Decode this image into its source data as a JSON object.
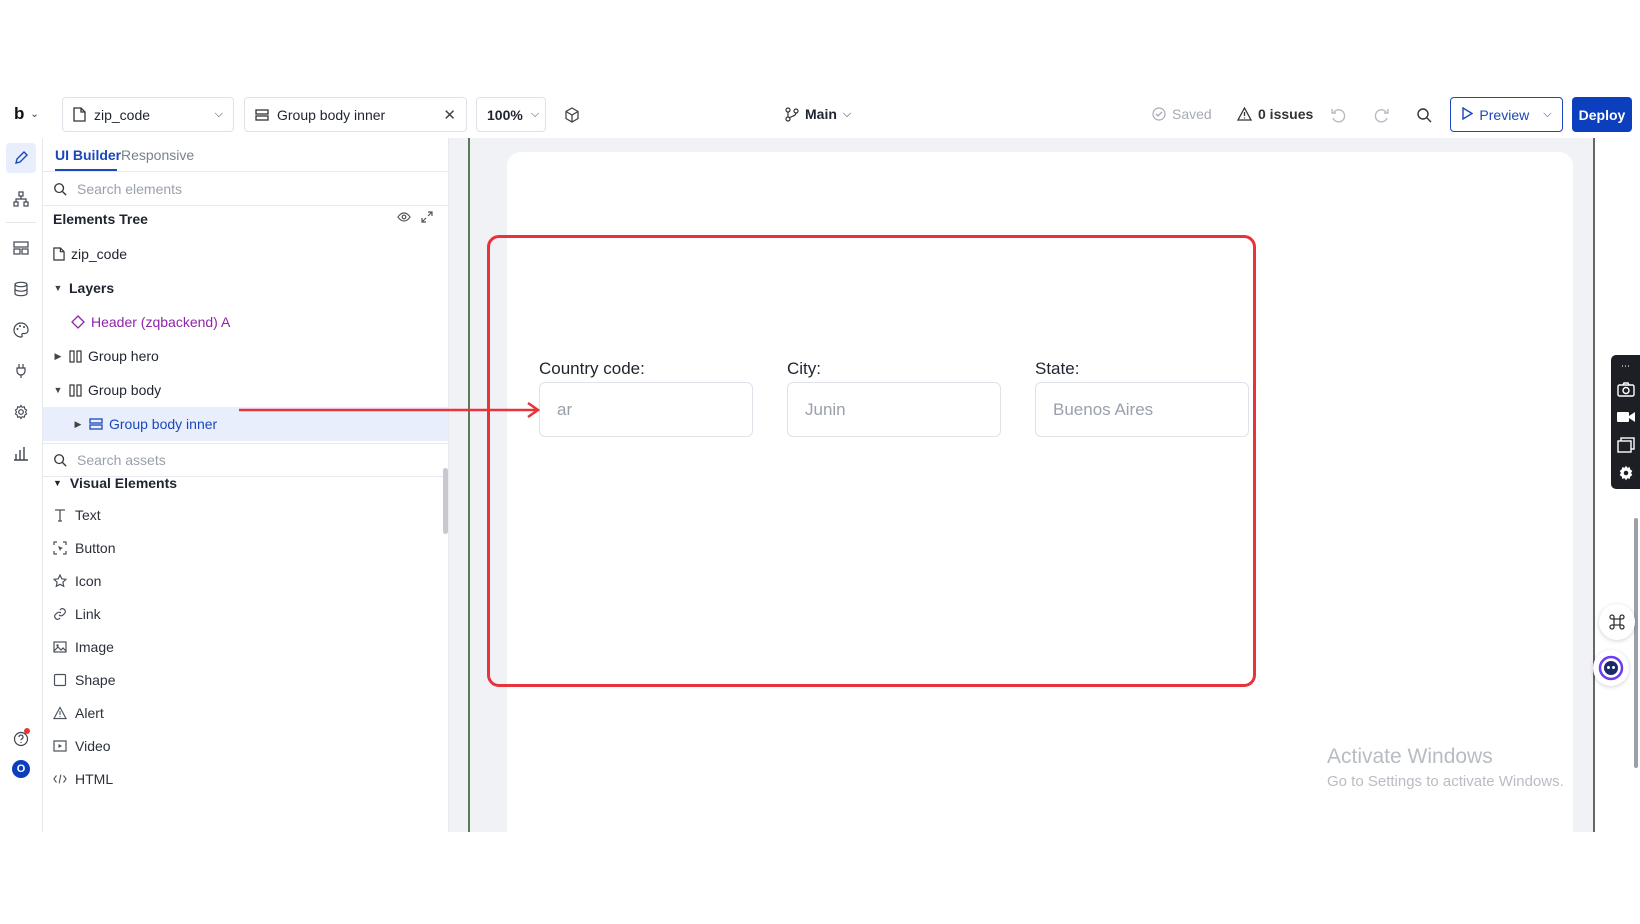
{
  "toolbar": {
    "logo": "b",
    "page_select": "zip_code",
    "element_select": "Group body inner",
    "zoom": "100%",
    "branch": "Main",
    "saved": "Saved",
    "issues": "0 issues",
    "preview": "Preview",
    "deploy": "Deploy"
  },
  "panel": {
    "tab_builder": "UI Builder",
    "tab_responsive": "Responsive",
    "search_elements_placeholder": "Search elements",
    "tree_title": "Elements Tree",
    "tree": {
      "page": "zip_code",
      "layers": "Layers",
      "header": "Header (zqbackend) A",
      "group_hero": "Group hero",
      "group_body": "Group body",
      "group_body_inner": "Group body inner"
    },
    "search_assets_placeholder": "Search assets",
    "visual_elements": "Visual Elements",
    "assets": [
      "Text",
      "Button",
      "Icon",
      "Link",
      "Image",
      "Shape",
      "Alert",
      "Video",
      "HTML"
    ]
  },
  "form": {
    "country_label": "Country code:",
    "country_value": "ar",
    "city_label": "City:",
    "city_value": "Junin",
    "state_label": "State:",
    "state_value": "Buenos Aires"
  },
  "watermark": {
    "title": "Activate Windows",
    "subtitle": "Go to Settings to activate Windows."
  },
  "colors": {
    "accent": "#1b47b8",
    "deploy_bg": "#0b3fbd",
    "highlight": "#e8323c",
    "layer_component": "#8e24aa"
  }
}
